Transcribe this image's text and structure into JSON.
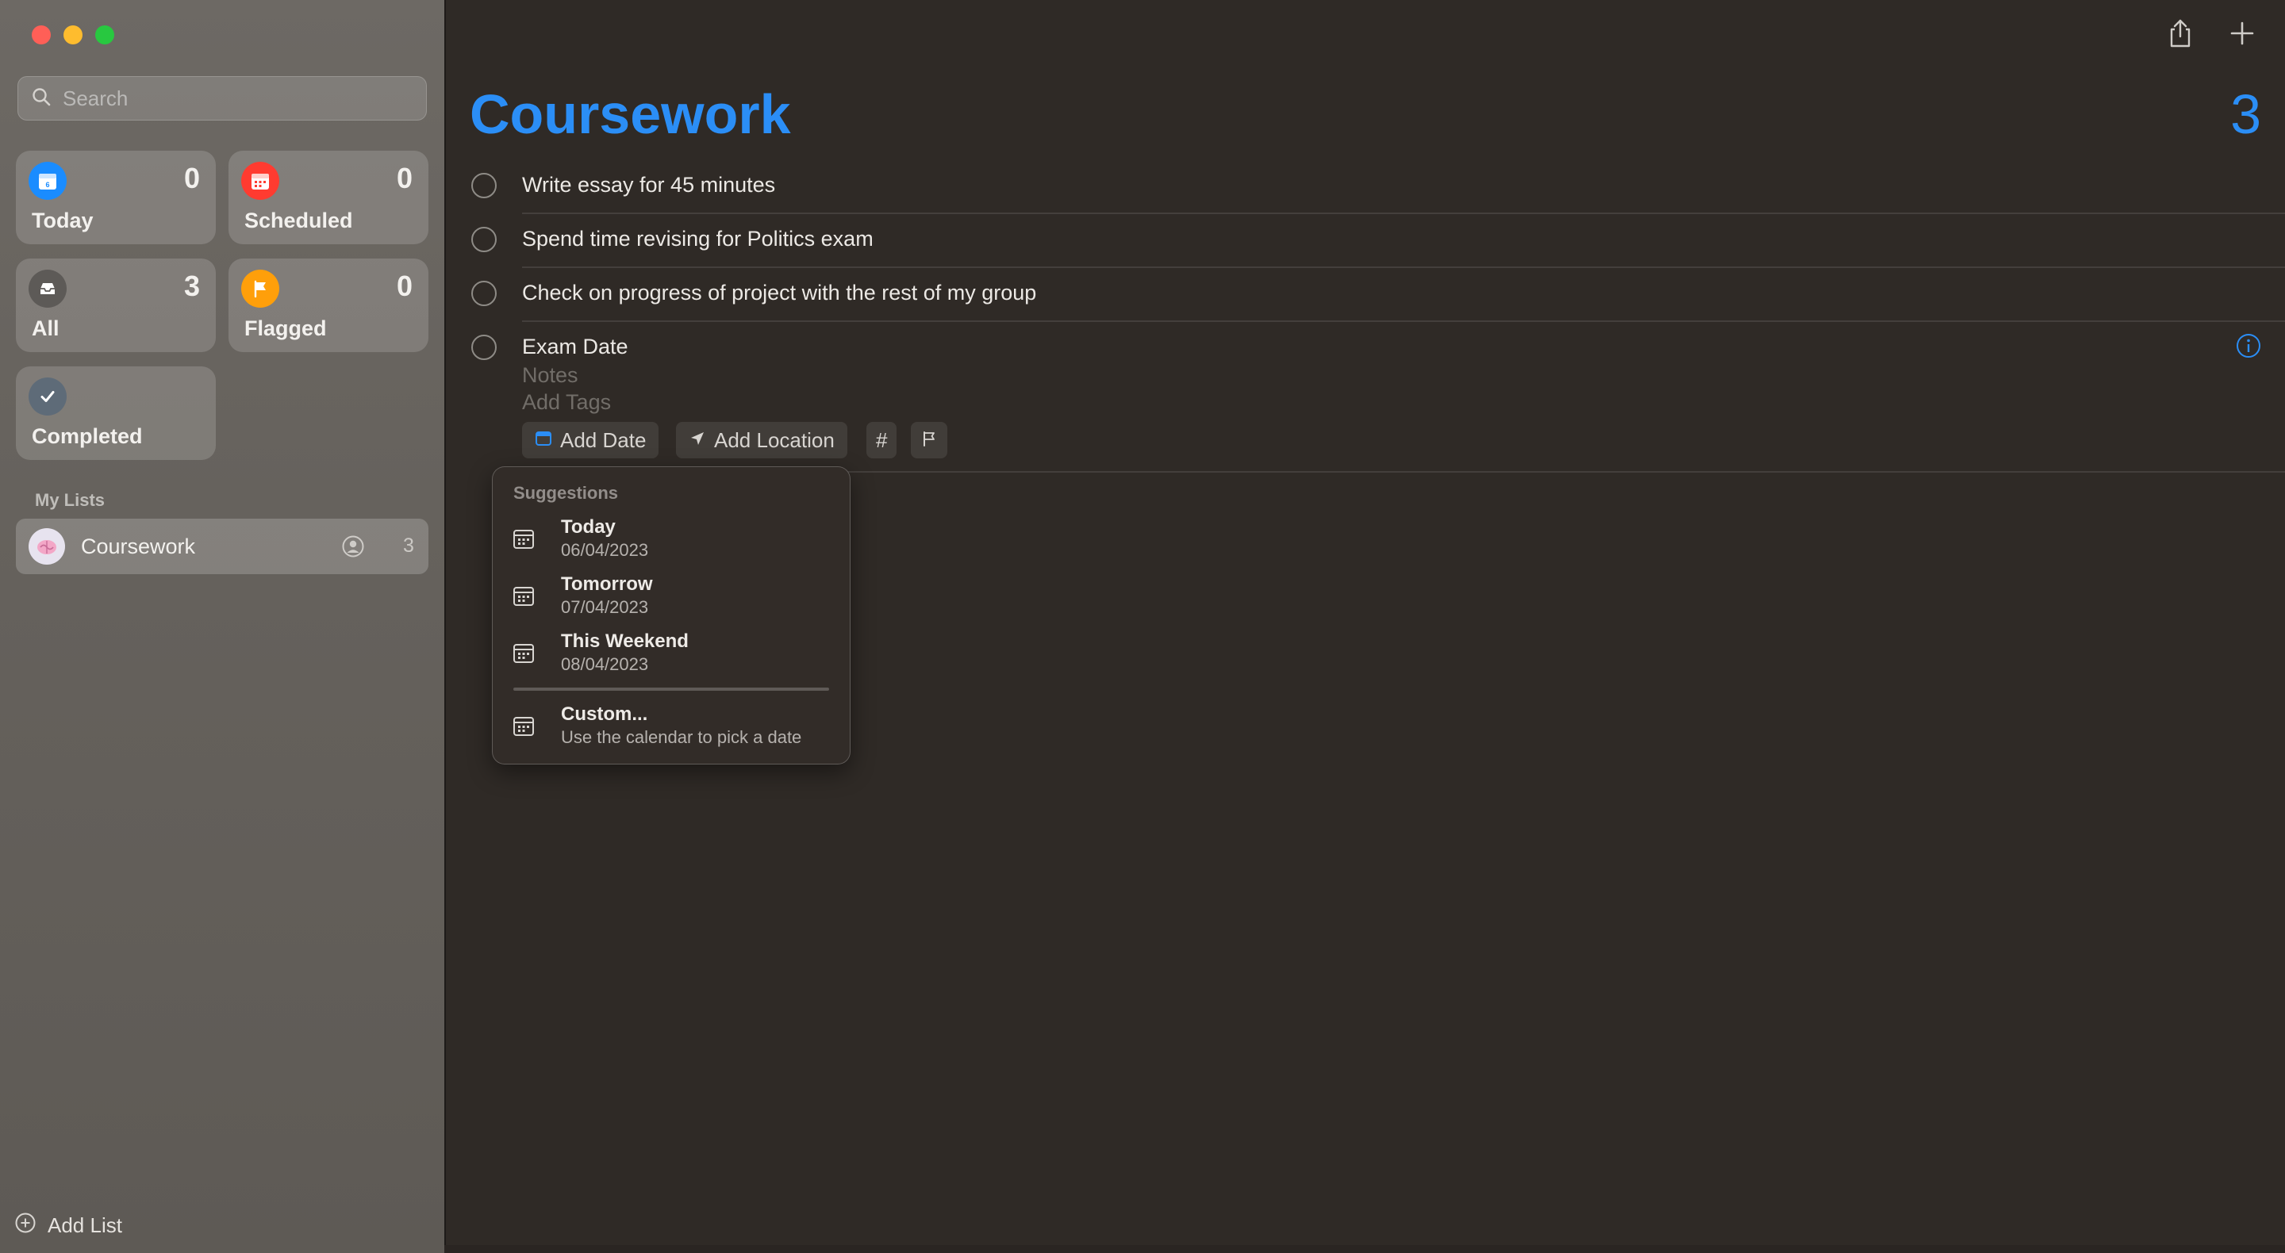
{
  "sidebar": {
    "search_placeholder": "Search",
    "smart_lists": [
      {
        "label": "Today",
        "count": "0",
        "color": "#1a8cff",
        "icon": "calendar-today-icon"
      },
      {
        "label": "Scheduled",
        "count": "0",
        "color": "#ff3b30",
        "icon": "calendar-icon"
      },
      {
        "label": "All",
        "count": "3",
        "color": "#5d5a57",
        "icon": "tray-icon"
      },
      {
        "label": "Flagged",
        "count": "0",
        "color": "#ff9f0a",
        "icon": "flag-icon"
      },
      {
        "label": "Completed",
        "count": "",
        "color": "#5e6b78",
        "icon": "checkmark-icon"
      }
    ],
    "my_lists_label": "My Lists",
    "lists": [
      {
        "name": "Coursework",
        "count": "3"
      }
    ],
    "add_list_label": "Add List"
  },
  "main": {
    "title": "Coursework",
    "count": "3",
    "accent": "#2b8ef6",
    "tasks": [
      {
        "text": "Write essay for 45 minutes"
      },
      {
        "text": "Spend time revising for Politics exam"
      },
      {
        "text": "Check on progress of project with the rest of my group"
      },
      {
        "text": "Exam Date"
      }
    ],
    "editing": {
      "notes_placeholder": "Notes",
      "tags_placeholder": "Add Tags",
      "add_date_label": "Add Date",
      "add_location_label": "Add Location",
      "tag_symbol": "#"
    }
  },
  "popover": {
    "heading": "Suggestions",
    "items": [
      {
        "title": "Today",
        "subtitle": "06/04/2023"
      },
      {
        "title": "Tomorrow",
        "subtitle": "07/04/2023"
      },
      {
        "title": "This Weekend",
        "subtitle": "08/04/2023"
      },
      {
        "title": "Custom...",
        "subtitle": "Use the calendar to pick a date"
      }
    ]
  }
}
